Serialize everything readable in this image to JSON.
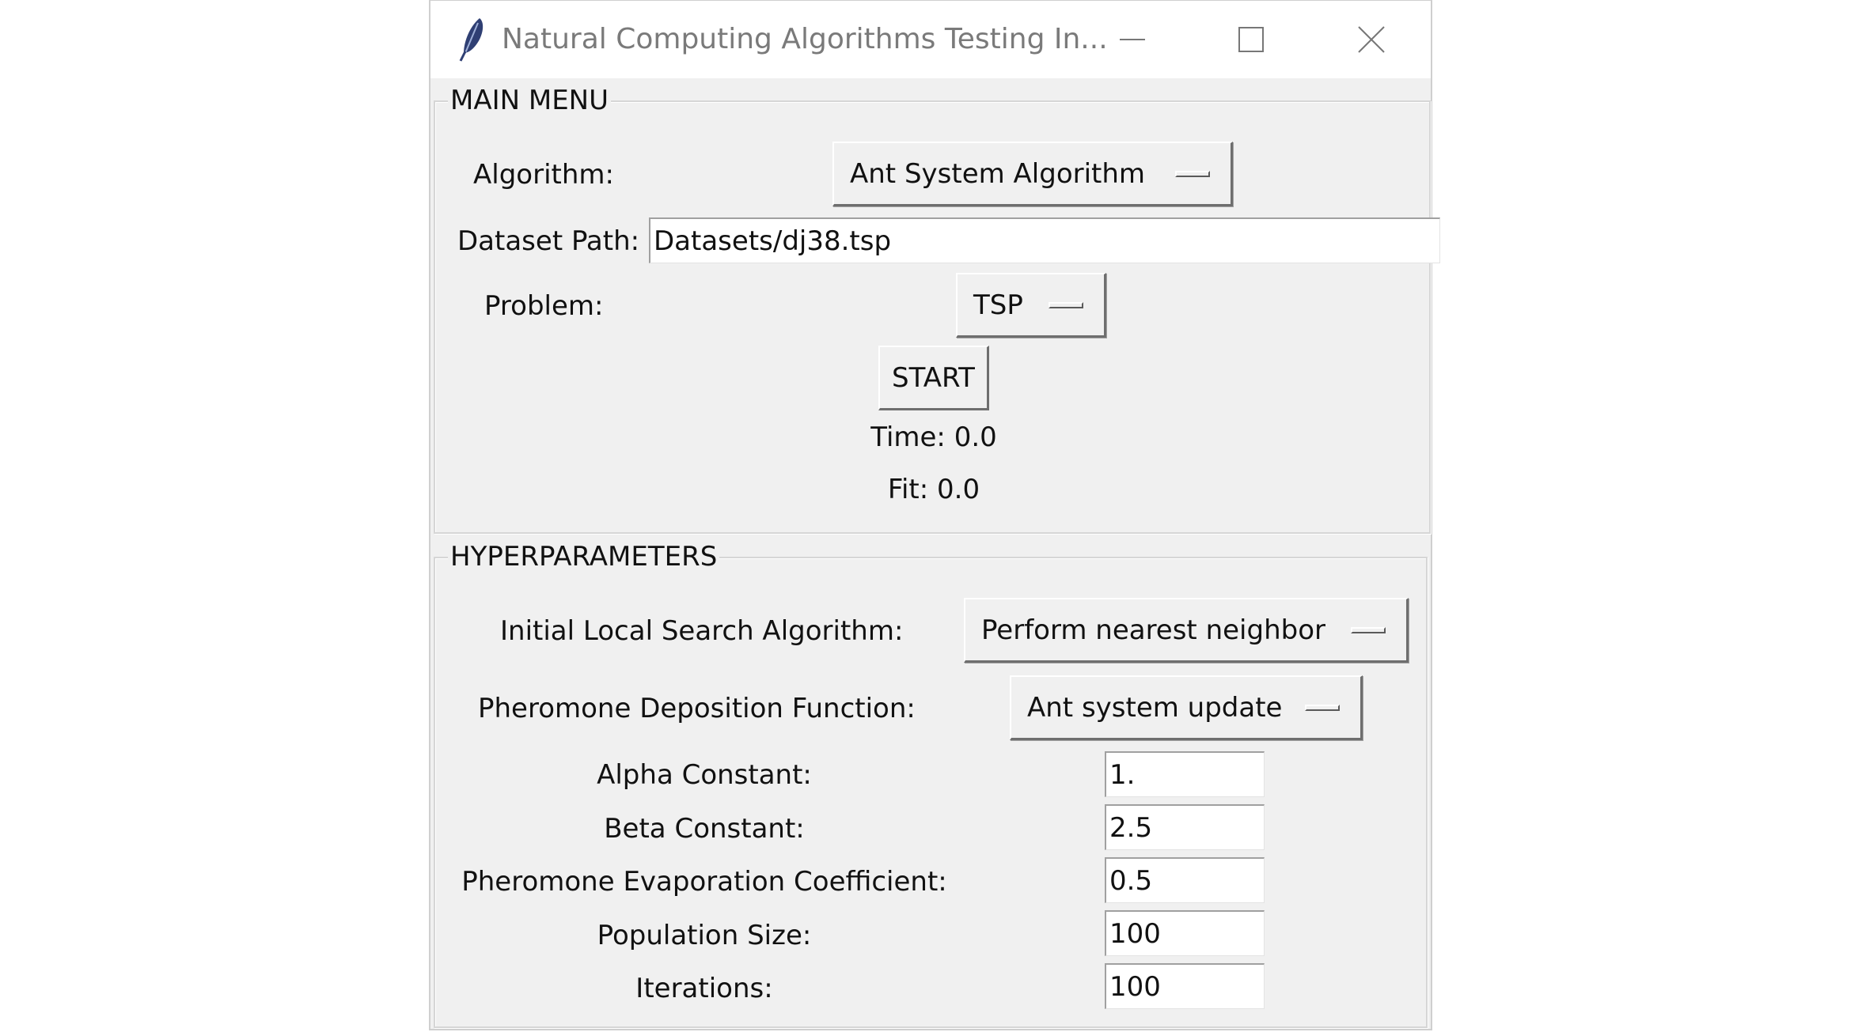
{
  "window": {
    "title": "Natural Computing Algorithms Testing In...",
    "icon": "feather-icon",
    "controls": {
      "minimize": "minimize-icon",
      "maximize": "maximize-icon",
      "close": "close-icon"
    }
  },
  "main_menu": {
    "label": "MAIN MENU",
    "algorithm_label": "Algorithm:",
    "algorithm_value": "Ant System Algorithm",
    "dataset_label": "Dataset Path:",
    "dataset_value": "Datasets/dj38.tsp",
    "problem_label": "Problem:",
    "problem_value": "TSP",
    "start_label": "START",
    "time_text": "Time: 0.0",
    "fit_text": "Fit: 0.0"
  },
  "hyperparameters": {
    "label": "HYPERPARAMETERS",
    "local_search_label": "Initial Local Search Algorithm:",
    "local_search_value": "Perform nearest neighbor",
    "deposition_label": "Pheromone Deposition Function:",
    "deposition_value": "Ant system update",
    "alpha_label": "Alpha Constant:",
    "alpha_value": "1.",
    "beta_label": "Beta Constant:",
    "beta_value": "2.5",
    "evaporation_label": "Pheromone Evaporation Coefficient:",
    "evaporation_value": "0.5",
    "population_label": "Population Size:",
    "population_value": "100",
    "iterations_label": "Iterations:",
    "iterations_value": "100"
  }
}
